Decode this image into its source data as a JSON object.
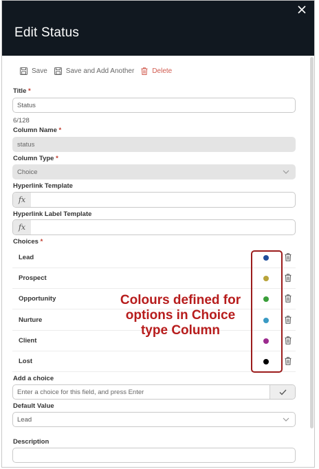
{
  "header": {
    "title": "Edit Status"
  },
  "toolbar": {
    "save": "Save",
    "save_add": "Save and Add Another",
    "delete": "Delete"
  },
  "fields": {
    "title": {
      "label": "Title",
      "required": "*",
      "value": "Status",
      "counter": "6/128"
    },
    "column_name": {
      "label": "Column Name",
      "required": "*",
      "value": "status"
    },
    "column_type": {
      "label": "Column Type",
      "required": "*",
      "value": "Choice"
    },
    "hyperlink_template": {
      "label": "Hyperlink Template",
      "fx": "fx"
    },
    "hyperlink_label_template": {
      "label": "Hyperlink Label Template",
      "fx": "fx"
    },
    "choices": {
      "label": "Choices",
      "required": "*",
      "items": [
        {
          "label": "Lead",
          "color": "#1f4e9c"
        },
        {
          "label": "Prospect",
          "color": "#b8a33a"
        },
        {
          "label": "Opportunity",
          "color": "#3a9e3a"
        },
        {
          "label": "Nurture",
          "color": "#3a9ac4"
        },
        {
          "label": "Client",
          "color": "#9c2a8e"
        },
        {
          "label": "Lost",
          "color": "#000000"
        }
      ]
    },
    "add_choice": {
      "label": "Add a choice",
      "placeholder": "Enter a choice for this field, and press Enter"
    },
    "default_value": {
      "label": "Default Value",
      "value": "Lead"
    },
    "description": {
      "label": "Description"
    }
  },
  "annotation": {
    "line1": "Colours defined for",
    "line2": "options in Choice",
    "line3": "type Column",
    "color": "#b71c1c"
  }
}
